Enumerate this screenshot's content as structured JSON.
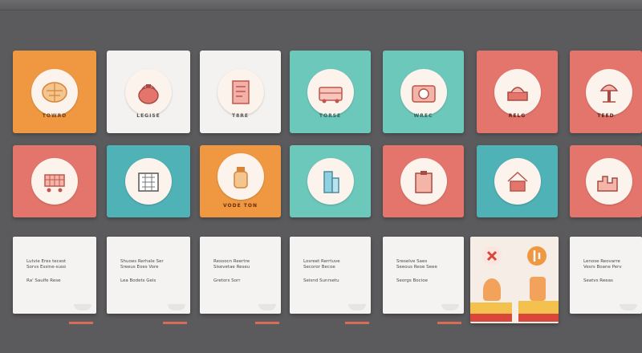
{
  "colors": {
    "orange": "#ef9841",
    "white": "#f4f2f0",
    "teal": "#6cc8bb",
    "coral": "#e4756c",
    "blue": "#4fb2b7",
    "accent": "#d96b57"
  },
  "row1": [
    {
      "icon": "brain-map-icon",
      "label": "TOWRD"
    },
    {
      "icon": "teapot-icon",
      "label": "LEGISE"
    },
    {
      "icon": "document-icon",
      "label": "T8RE"
    },
    {
      "icon": "bus-icon",
      "label": "TORSE"
    },
    {
      "icon": "camera-icon",
      "label": "WREC"
    },
    {
      "icon": "hat-icon",
      "label": "RELG"
    },
    {
      "icon": "tree-icon",
      "label": "TEED"
    }
  ],
  "row2": [
    {
      "icon": "cart-icon",
      "label": ""
    },
    {
      "icon": "building-icon",
      "label": ""
    },
    {
      "icon": "bottle-icon",
      "label": "VODE   TON"
    },
    {
      "icon": "tower-icon",
      "label": ""
    },
    {
      "icon": "clipboard-icon",
      "label": ""
    },
    {
      "icon": "house-icon",
      "label": ""
    },
    {
      "icon": "city-icon",
      "label": ""
    }
  ],
  "row3": [
    {
      "lines": [
        "Lutvie Eres tecest",
        "Sorvs Essine-suso",
        "Ra' Saulfe Rese"
      ]
    },
    {
      "lines": [
        "Shuoes Rerhale Ser",
        "Sreeus Eoes Vore",
        "Lea Bodets Geis"
      ]
    },
    {
      "lines": [
        "Resoocn Reertre",
        "Sisevetae Reseu",
        "Gretors Sorr"
      ]
    },
    {
      "lines": [
        "Losreet Rerrtuve",
        "Secoror Becoe",
        "Seisnd Sunrsetu"
      ]
    },
    {
      "lines": [
        "Sreselve Saes",
        "Seeous Reoe Seee",
        "Seorgs Bocioe"
      ]
    },
    {
      "lines": []
    },
    {
      "lines": [
        "Lenose Reovarre",
        "Vesrs Boane Perv",
        "Seatvs Reeas"
      ]
    }
  ]
}
